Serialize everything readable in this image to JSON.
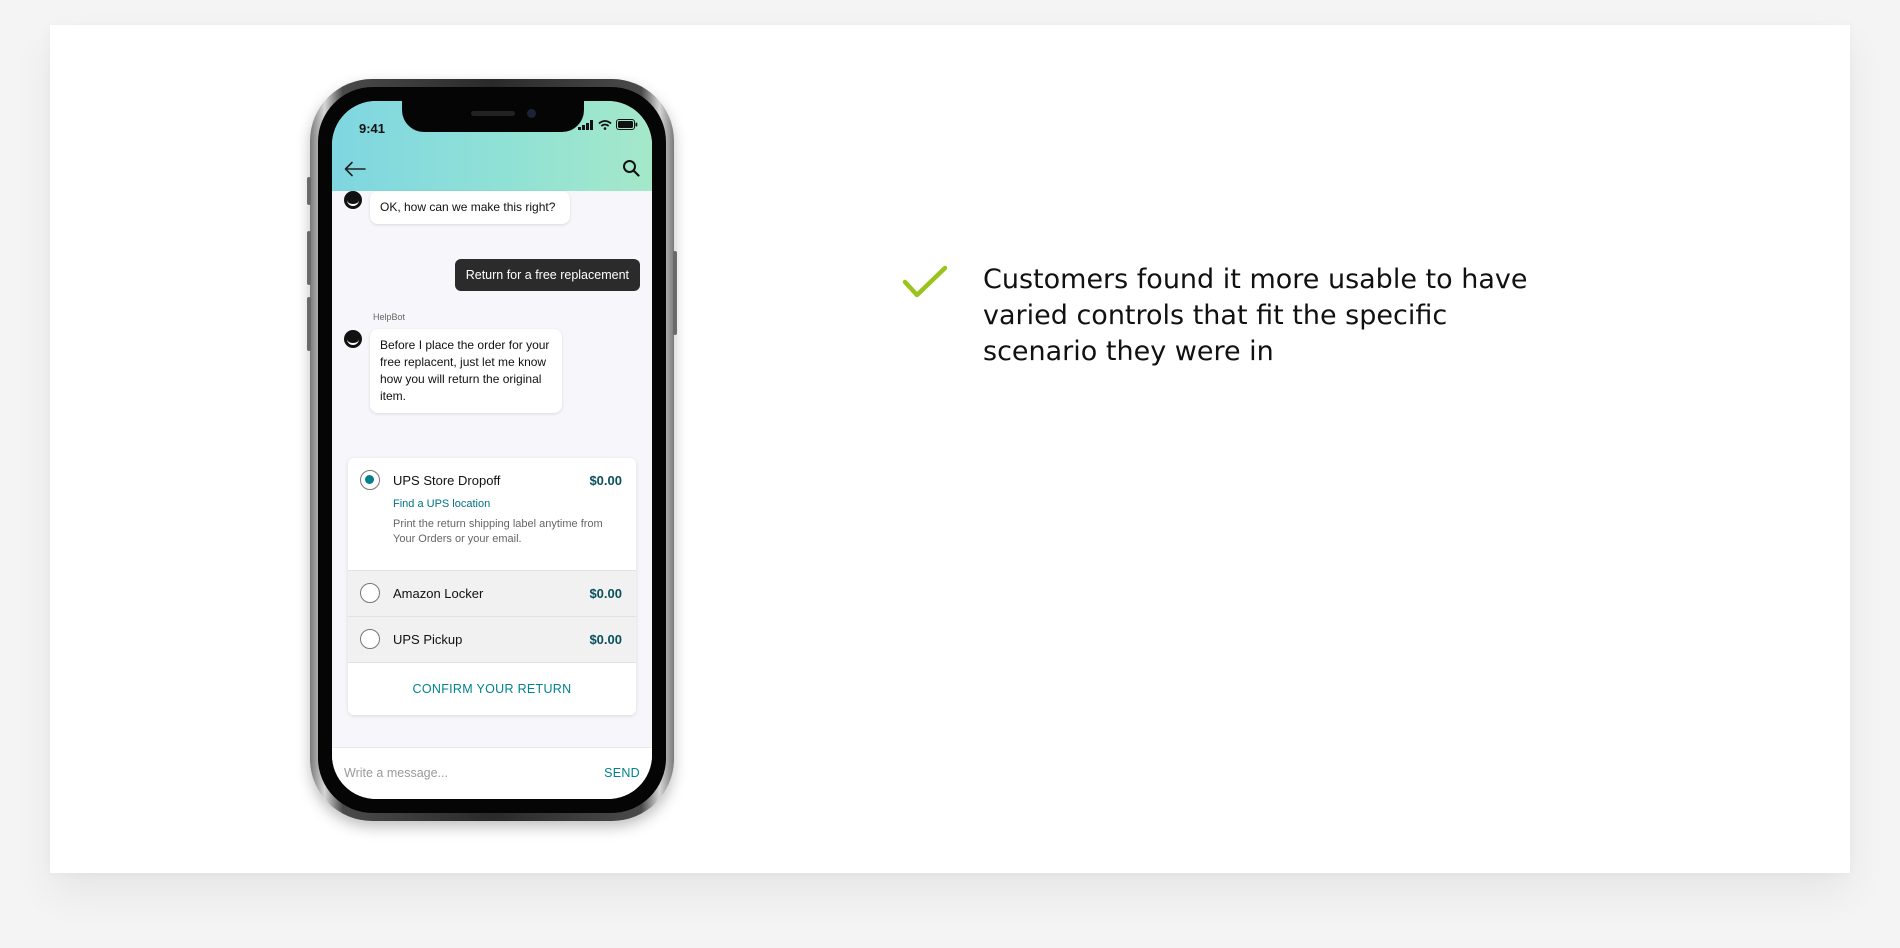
{
  "phone": {
    "status_time": "9:41",
    "chat": {
      "bot_message_1": "OK, how can we make this right?",
      "user_message": "Return for a free replacement",
      "bot_name": "HelpBot",
      "bot_message_2": "Before I place the order for your free replacent, just let me know how you will return the original item."
    },
    "return_options": [
      {
        "name": "UPS Store Dropoff",
        "price": "$0.00",
        "selected": true,
        "link": "Find a UPS location",
        "description": "Print the return shipping label anytime from Your Orders or your email."
      },
      {
        "name": "Amazon Locker",
        "price": "$0.00",
        "selected": false
      },
      {
        "name": "UPS Pickup",
        "price": "$0.00",
        "selected": false
      }
    ],
    "confirm_label": "CONFIRM YOUR RETURN",
    "composer": {
      "placeholder": "Write a message...",
      "send_label": "SEND"
    }
  },
  "insight": {
    "text": "Customers found it more usable to have varied controls that fit the specific scenario they were in",
    "check_color": "#9ac31c"
  },
  "colors": {
    "accent": "#00828f",
    "header_gradient_start": "#7fd6e1",
    "header_gradient_end": "#a5e8c9"
  }
}
